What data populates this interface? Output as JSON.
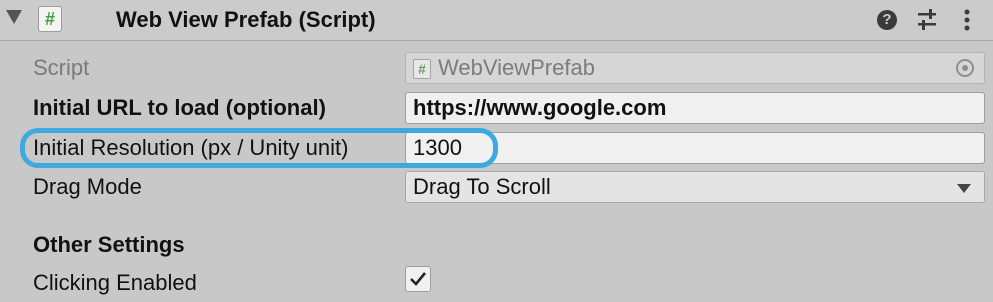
{
  "component": {
    "title": "Web View Prefab (Script)",
    "script_icon_glyph": "#",
    "icons": [
      "help-icon",
      "presets-icon",
      "menu-icon"
    ]
  },
  "fields": {
    "script": {
      "label": "Script",
      "value": "WebViewPrefab",
      "icon_glyph": "#"
    },
    "initial_url": {
      "label": "Initial URL to load (optional)",
      "value": "https://www.google.com"
    },
    "initial_resolution": {
      "label": "Initial Resolution (px / Unity unit)",
      "value": "1300"
    },
    "drag_mode": {
      "label": "Drag Mode",
      "value": "Drag To Scroll"
    }
  },
  "other_settings": {
    "heading": "Other Settings",
    "clicking_enabled": {
      "label": "Clicking Enabled",
      "checked": true
    }
  },
  "colors": {
    "highlight": "#3ea9e0",
    "script_icon_green": "#3f9d3c"
  }
}
